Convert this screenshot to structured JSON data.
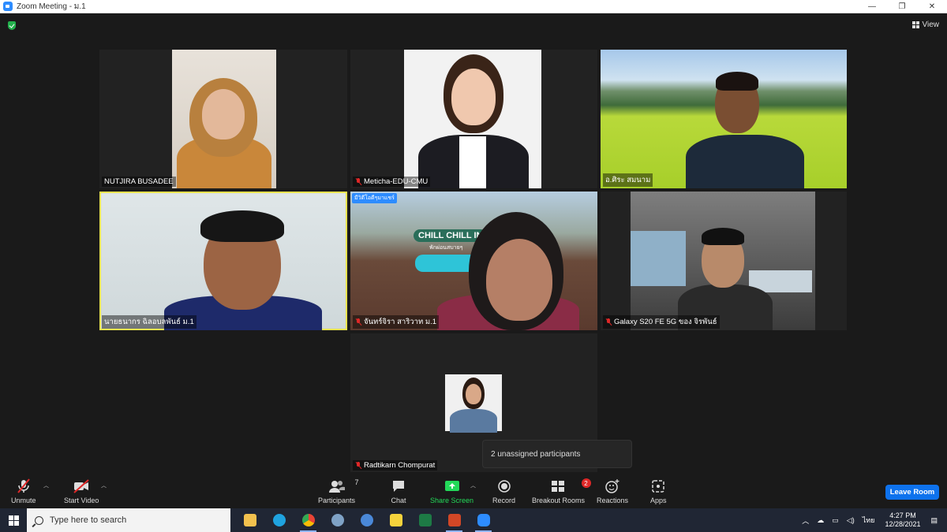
{
  "window": {
    "title": "Zoom Meeting - ม.1",
    "minimize": "—",
    "restore": "❐",
    "close": "✕"
  },
  "view_label": "View",
  "participants_tiles": [
    {
      "name": "NUTJIRA BUSADEE",
      "muted": false
    },
    {
      "name": "Meticha-EDU-CMU",
      "muted": true
    },
    {
      "name": "อ.ศิระ สมนาม",
      "muted": false
    },
    {
      "name": "นายธนากร  ฉิลอบลพันธ์ ม.1",
      "muted": false
    },
    {
      "name": "จันทร์จิรา สาริวาท ม.1",
      "muted": true
    },
    {
      "name": "Galaxy S20 FE 5G ของ จิรพันธ์",
      "muted": true
    },
    {
      "name": "Radtikarn Chompurat",
      "muted": true
    }
  ],
  "background_text": {
    "banner": "CHILL CHILL IN",
    "badge": "มีวิดีโอดีๆมาแชร์",
    "sub": "พักผ่อนสบายๆ"
  },
  "popup": "2 unassigned participants",
  "toolbar": {
    "unmute": "Unmute",
    "start_video": "Start Video",
    "participants": "Participants",
    "participants_count": "7",
    "chat": "Chat",
    "share_screen": "Share Screen",
    "record": "Record",
    "breakout_rooms": "Breakout Rooms",
    "breakout_badge": "2",
    "reactions": "Reactions",
    "apps": "Apps",
    "leave_room": "Leave Room"
  },
  "taskbar": {
    "search_placeholder": "Type here to search",
    "lang": "ไทย",
    "time": "4:27 PM",
    "date": "12/28/2021"
  },
  "colors": {
    "active_speaker_border": "#e8e34f",
    "share_green": "#23d959",
    "leave_blue": "#0e72ed",
    "muted_red": "#e02828"
  }
}
